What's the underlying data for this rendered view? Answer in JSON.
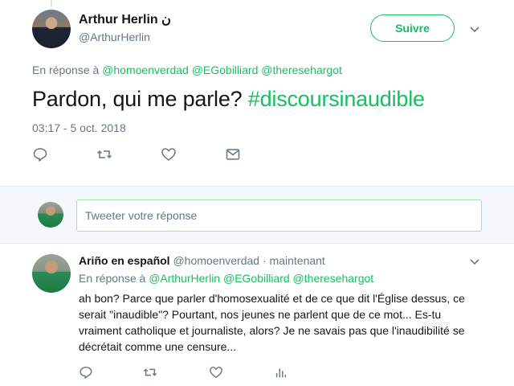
{
  "main_tweet": {
    "author_name": "Arthur Herlin",
    "author_badge": "ن",
    "author_handle": "@ArthurHerlin",
    "follow_label": "Suivre",
    "reply_prefix": "En réponse à",
    "reply_mentions": "@homoenverdad @EGobilliard @theresehargot",
    "text": "Pardon, qui me parle?",
    "hashtag": "#discoursinaudible",
    "timestamp": "03:17 - 5 oct. 2018",
    "actions": [
      "reply-icon",
      "retweet-icon",
      "like-icon",
      "message-icon"
    ]
  },
  "composer": {
    "placeholder": "Tweeter votre réponse"
  },
  "reply_tweet": {
    "author_name": "Ariño en español",
    "author_handle": "@homoenverdad",
    "separator": "·",
    "time": "maintenant",
    "reply_prefix": "En réponse à",
    "reply_mentions": "@ArthurHerlin @EGobilliard @theresehargot",
    "text": "ah bon? Parce que parler d'homosexualité et de ce que dit l'Église dessus, ce serait \"inaudible\"? Pourtant, nos jeunes ne parlent que de ce mot... Es-tu vraiment catholique et journaliste, alors? Je ne savais pas que l'inaudibilité se décrétait comme une censure...",
    "actions": [
      "reply-icon",
      "retweet-icon",
      "like-icon",
      "analytics-icon"
    ]
  },
  "colors": {
    "accent": "#17bf63",
    "muted": "#657786",
    "text": "#14171a",
    "border": "#e6ecf0"
  }
}
